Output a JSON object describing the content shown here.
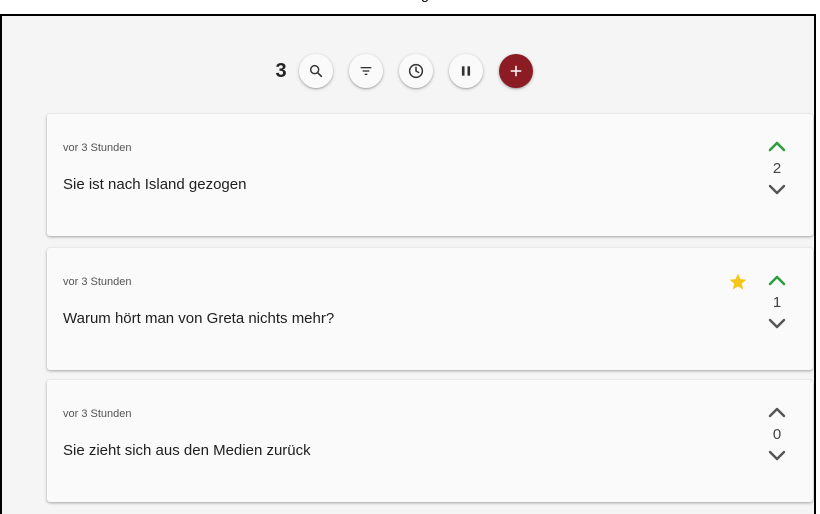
{
  "header": {
    "title_fragment": "g"
  },
  "toolbar": {
    "count": "3",
    "buttons": [
      {
        "icon": "search-icon"
      },
      {
        "icon": "filter-icon"
      },
      {
        "icon": "clock-icon"
      },
      {
        "icon": "pause-icon"
      },
      {
        "icon": "plus-icon"
      }
    ],
    "add_color": "#8b1c24"
  },
  "colors": {
    "upvote_active": "#2e9e3e",
    "vote_inactive": "#555555",
    "star": "#f5c518"
  },
  "entries": [
    {
      "time": "vor 3 Stunden",
      "text": "Sie ist nach Island gezogen",
      "votes": "2",
      "upvoted": true,
      "starred": false
    },
    {
      "time": "vor 3 Stunden",
      "text": "Warum hört man von Greta nichts mehr?",
      "votes": "1",
      "upvoted": true,
      "starred": true
    },
    {
      "time": "vor 3 Stunden",
      "text": "Sie zieht sich aus den Medien zurück",
      "votes": "0",
      "upvoted": false,
      "starred": false
    }
  ]
}
